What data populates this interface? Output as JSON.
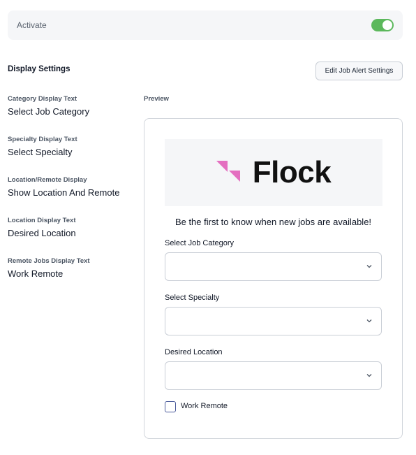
{
  "activate": {
    "label": "Activate",
    "enabled": true,
    "toggle_color": "#5cb85c"
  },
  "display_settings": {
    "title": "Display Settings",
    "edit_button": "Edit Job Alert Settings",
    "items": [
      {
        "label": "Category Display Text",
        "value": "Select Job Category"
      },
      {
        "label": "Specialty Display Text",
        "value": "Select Specialty"
      },
      {
        "label": "Location/Remote Display",
        "value": "Show Location And Remote"
      },
      {
        "label": "Location Display Text",
        "value": "Desired Location"
      },
      {
        "label": "Remote Jobs Display Text",
        "value": "Work Remote"
      }
    ]
  },
  "preview": {
    "label": "Preview",
    "logo_text": "Flock",
    "logo_color": "#e46fc0",
    "tagline": "Be the first to know when new jobs are available!",
    "fields": [
      {
        "label": "Select Job Category",
        "value": ""
      },
      {
        "label": "Select Specialty",
        "value": ""
      },
      {
        "label": "Desired Location",
        "value": ""
      }
    ],
    "checkbox_label": "Work Remote",
    "checkbox_checked": false
  }
}
